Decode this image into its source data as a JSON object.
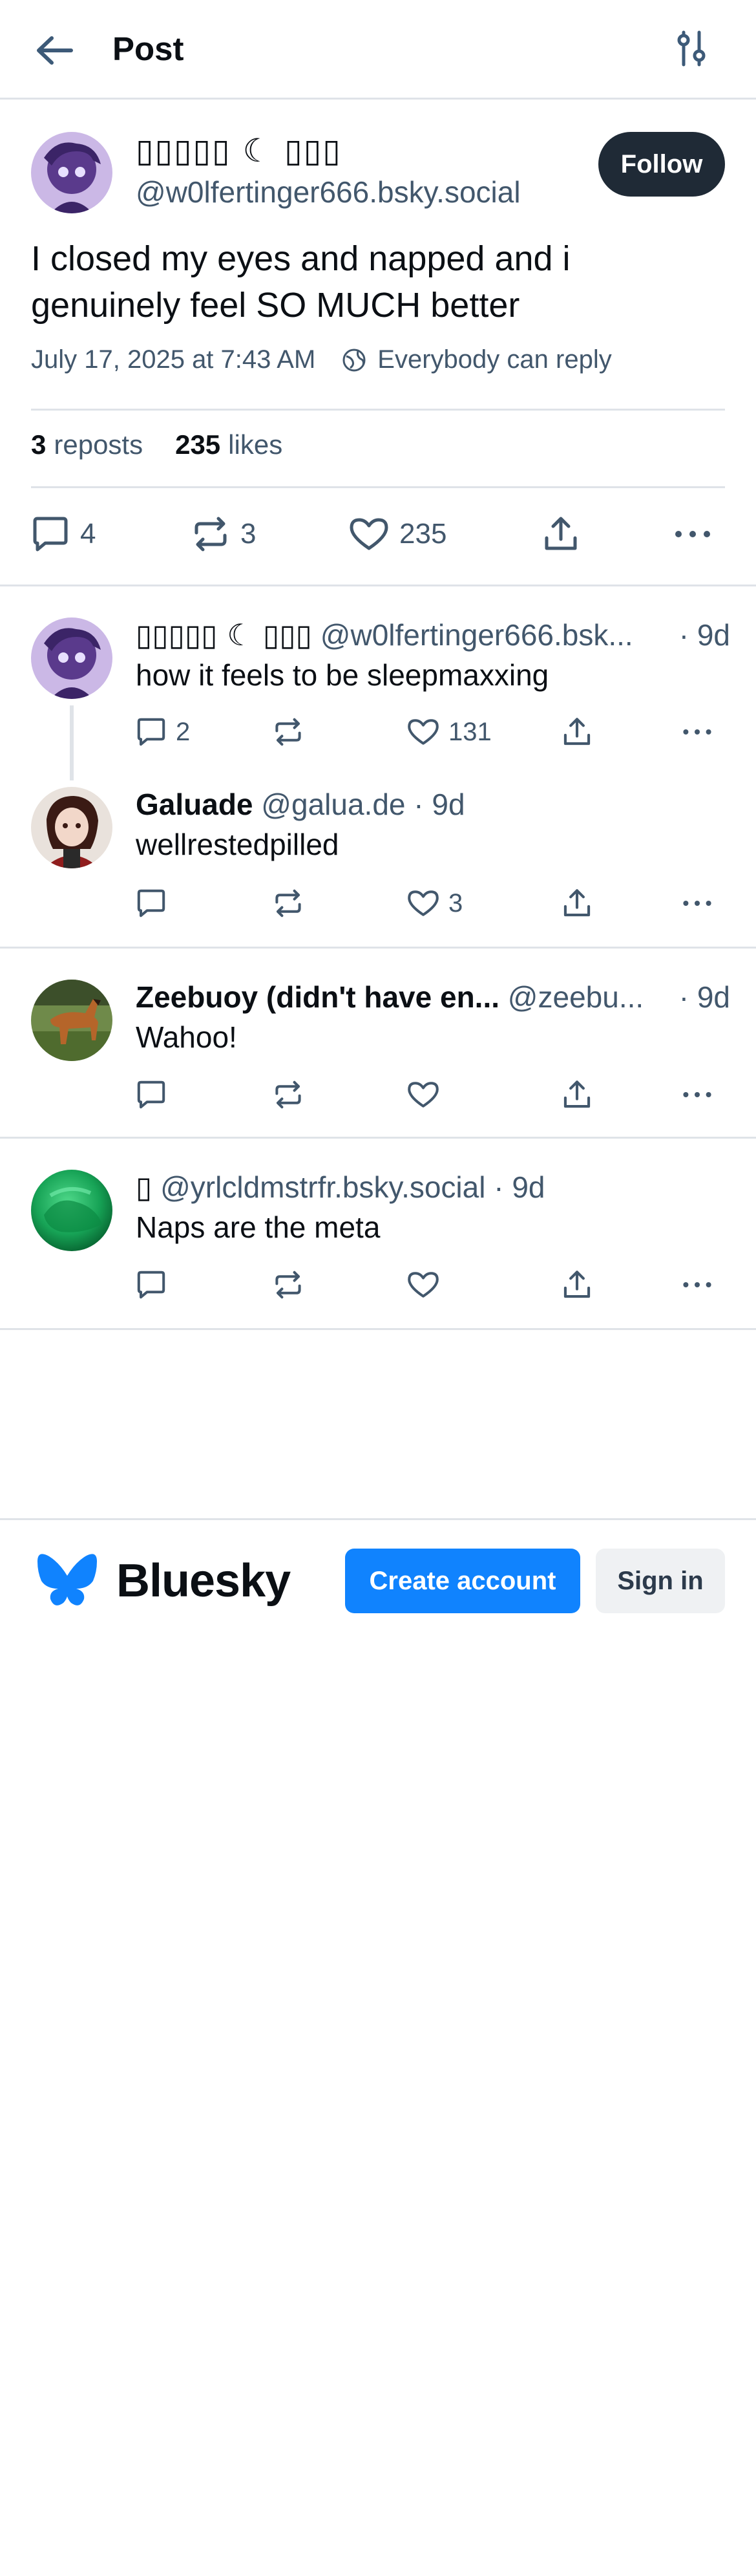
{
  "header": {
    "title": "Post"
  },
  "post": {
    "author_name": "▯▯▯▯▯ ☾ ▯▯▯",
    "author_handle": "@w0lfertinger666.bsky.social",
    "follow_label": "Follow",
    "text": "I closed my eyes and napped and i genuinely feel SO MUCH better",
    "date": "July 17, 2025 at 7:43 AM",
    "reply_permission": "Everybody can reply",
    "reposts_count": "3",
    "reposts_label": "reposts",
    "likes_count": "235",
    "likes_label": "likes",
    "actions": {
      "replies": "4",
      "reposts": "3",
      "likes": "235"
    }
  },
  "replies": [
    {
      "name": "▯▯▯▯▯ ☾ ▯▯▯",
      "handle": "@w0lfertinger666.bsk...",
      "time": "· 9d",
      "text": "how it feels to be sleepmaxxing",
      "replies": "2",
      "reposts": "",
      "likes": "131"
    },
    {
      "name": "Galuade",
      "handle": "@galua.de",
      "time": "· 9d",
      "text": "wellrestedpilled",
      "replies": "",
      "reposts": "",
      "likes": "3"
    },
    {
      "name": "Zeebuoy (didn't have en...",
      "handle": "@zeebu...",
      "time": "· 9d",
      "text": "Wahoo!",
      "replies": "",
      "reposts": "",
      "likes": ""
    },
    {
      "name": "▯",
      "handle": "@yrlcldmstrfr.bsky.social",
      "time": "· 9d",
      "text": "Naps are the meta",
      "replies": "",
      "reposts": "",
      "likes": ""
    }
  ],
  "footer": {
    "brand": "Bluesky",
    "create_account": "Create account",
    "sign_in": "Sign in"
  },
  "colors": {
    "accent": "#1083fe",
    "text": "#0b0f14",
    "muted": "#42576c",
    "divider": "#dfe3e8",
    "follow_bg": "#1f2a36"
  },
  "icons": [
    "back-arrow-icon",
    "filter-sliders-icon",
    "globe-icon",
    "reply-icon",
    "repost-icon",
    "like-icon",
    "share-icon",
    "more-icon",
    "bluesky-butterfly-icon"
  ]
}
